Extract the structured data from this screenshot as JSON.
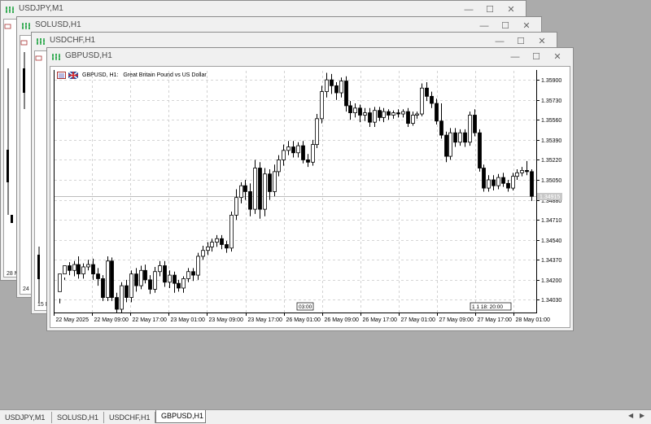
{
  "windows": [
    {
      "title": "USDJPY,M1",
      "stub_time": "28 M"
    },
    {
      "title": "SOLUSD,H1",
      "stub_time": "24 M"
    },
    {
      "title": "USDCHF,H1",
      "stub_time": "15 M"
    },
    {
      "title": "GBPUSD,H1"
    }
  ],
  "chart_window": {
    "header_symbol": "GBPUSD, H1:",
    "header_desc": "Great Britain Pound vs US Dollar",
    "current_price": "1.34915",
    "scroll_label_left": "03:00",
    "scroll_label_right": "1 1 18: 20:00"
  },
  "chart_data": {
    "type": "candlestick",
    "symbol": "GBPUSD",
    "timeframe": "H1",
    "ylim": [
      1.3395,
      1.3597
    ],
    "yticks": [
      "1.35900",
      "1.35730",
      "1.35560",
      "1.35390",
      "1.35220",
      "1.35050",
      "1.34880",
      "1.34710",
      "1.34540",
      "1.34370",
      "1.34200",
      "1.34030"
    ],
    "xticks": [
      "22 May 2025",
      "22 May 09:00",
      "22 May 17:00",
      "23 May 01:00",
      "23 May 09:00",
      "23 May 17:00",
      "26 May 01:00",
      "26 May 09:00",
      "26 May 17:00",
      "27 May 01:00",
      "27 May 09:00",
      "27 May 17:00",
      "28 May 01:00"
    ],
    "last_price": 1.34915,
    "candles": [
      [
        1.341,
        1.3425,
        1.3404,
        1.34
      ],
      [
        1.3425,
        1.3432,
        1.3422,
        1.342
      ],
      [
        1.3432,
        1.3428,
        1.3435,
        1.3424
      ],
      [
        1.3428,
        1.3433,
        1.3436,
        1.3423
      ],
      [
        1.3433,
        1.3425,
        1.344,
        1.3421
      ],
      [
        1.3425,
        1.3431,
        1.3434,
        1.3421
      ],
      [
        1.3431,
        1.3433,
        1.3437,
        1.3428
      ],
      [
        1.3433,
        1.3425,
        1.3438,
        1.342
      ],
      [
        1.3425,
        1.3421,
        1.343,
        1.3415
      ],
      [
        1.3421,
        1.3405,
        1.3424,
        1.3402
      ],
      [
        1.3405,
        1.3436,
        1.344,
        1.3402
      ],
      [
        1.3436,
        1.3405,
        1.3439,
        1.3402
      ],
      [
        1.3405,
        1.3395,
        1.3409,
        1.3392
      ],
      [
        1.3395,
        1.3415,
        1.3418,
        1.3392
      ],
      [
        1.3415,
        1.3405,
        1.342,
        1.3401
      ],
      [
        1.3405,
        1.3425,
        1.3428,
        1.3401
      ],
      [
        1.3425,
        1.3415,
        1.343,
        1.341
      ],
      [
        1.3415,
        1.3428,
        1.3432,
        1.3412
      ],
      [
        1.3428,
        1.342,
        1.3433,
        1.3417
      ],
      [
        1.342,
        1.3412,
        1.3424,
        1.3408
      ],
      [
        1.3412,
        1.3427,
        1.3431,
        1.3409
      ],
      [
        1.3427,
        1.3432,
        1.3436,
        1.3423
      ],
      [
        1.3432,
        1.3418,
        1.3436,
        1.3414
      ],
      [
        1.3418,
        1.3424,
        1.3428,
        1.3413
      ],
      [
        1.3424,
        1.3417,
        1.3427,
        1.3409
      ],
      [
        1.3417,
        1.3413,
        1.342,
        1.341
      ],
      [
        1.3413,
        1.3421,
        1.3423,
        1.3409
      ],
      [
        1.3421,
        1.3427,
        1.343,
        1.3418
      ],
      [
        1.3427,
        1.3424,
        1.343,
        1.3419
      ],
      [
        1.3424,
        1.344,
        1.3443,
        1.342
      ],
      [
        1.344,
        1.3445,
        1.3449,
        1.3437
      ],
      [
        1.3445,
        1.3448,
        1.3452,
        1.3441
      ],
      [
        1.3448,
        1.3452,
        1.3455,
        1.3444
      ],
      [
        1.3452,
        1.3455,
        1.3458,
        1.3448
      ],
      [
        1.3455,
        1.345,
        1.3458,
        1.3446
      ],
      [
        1.345,
        1.3447,
        1.3453,
        1.3443
      ],
      [
        1.3447,
        1.3475,
        1.3478,
        1.3444
      ],
      [
        1.3475,
        1.349,
        1.3497,
        1.3471
      ],
      [
        1.349,
        1.35,
        1.3503,
        1.3485
      ],
      [
        1.35,
        1.3495,
        1.3505,
        1.3488
      ],
      [
        1.3495,
        1.348,
        1.3502,
        1.3474
      ],
      [
        1.348,
        1.3515,
        1.3522,
        1.3476
      ],
      [
        1.3515,
        1.348,
        1.352,
        1.3472
      ],
      [
        1.348,
        1.351,
        1.3515,
        1.3474
      ],
      [
        1.351,
        1.3495,
        1.3514,
        1.3488
      ],
      [
        1.3495,
        1.3512,
        1.3518,
        1.3491
      ],
      [
        1.3512,
        1.3522,
        1.3526,
        1.3508
      ],
      [
        1.3522,
        1.353,
        1.3535,
        1.3517
      ],
      [
        1.353,
        1.3533,
        1.3538,
        1.3526
      ],
      [
        1.3533,
        1.3528,
        1.3538,
        1.3524
      ],
      [
        1.3528,
        1.3534,
        1.3537,
        1.3524
      ],
      [
        1.3534,
        1.3522,
        1.3538,
        1.3519
      ],
      [
        1.3522,
        1.352,
        1.3527,
        1.3516
      ],
      [
        1.352,
        1.3535,
        1.3539,
        1.3517
      ],
      [
        1.3535,
        1.3557,
        1.3561,
        1.3532
      ],
      [
        1.3557,
        1.358,
        1.3585,
        1.3553
      ],
      [
        1.358,
        1.359,
        1.3596,
        1.3575
      ],
      [
        1.359,
        1.3585,
        1.3595,
        1.3578
      ],
      [
        1.3585,
        1.3579,
        1.3588,
        1.3573
      ],
      [
        1.3579,
        1.3589,
        1.3592,
        1.3575
      ],
      [
        1.3589,
        1.3568,
        1.3593,
        1.3563
      ],
      [
        1.3568,
        1.3562,
        1.3572,
        1.3556
      ],
      [
        1.3562,
        1.3566,
        1.357,
        1.3558
      ],
      [
        1.3566,
        1.356,
        1.3569,
        1.3554
      ],
      [
        1.356,
        1.3562,
        1.3566,
        1.3555
      ],
      [
        1.3562,
        1.3554,
        1.3566,
        1.355
      ],
      [
        1.3554,
        1.3564,
        1.3567,
        1.355
      ],
      [
        1.3564,
        1.3558,
        1.3567,
        1.3555
      ],
      [
        1.3558,
        1.3563,
        1.3566,
        1.3554
      ],
      [
        1.3563,
        1.356,
        1.3565,
        1.3556
      ],
      [
        1.356,
        1.3562,
        1.3564,
        1.3557
      ],
      [
        1.3562,
        1.3561,
        1.3565,
        1.3558
      ],
      [
        1.3561,
        1.3563,
        1.3565,
        1.3558
      ],
      [
        1.3563,
        1.3553,
        1.3566,
        1.355
      ],
      [
        1.3553,
        1.356,
        1.3563,
        1.3551
      ],
      [
        1.356,
        1.3561,
        1.3563,
        1.3557
      ],
      [
        1.3561,
        1.3583,
        1.3587,
        1.3559
      ],
      [
        1.3583,
        1.3576,
        1.3588,
        1.3572
      ],
      [
        1.3576,
        1.357,
        1.358,
        1.3566
      ],
      [
        1.357,
        1.3555,
        1.3574,
        1.3552
      ],
      [
        1.3555,
        1.3543,
        1.357,
        1.354
      ],
      [
        1.3543,
        1.3525,
        1.3546,
        1.352
      ],
      [
        1.3525,
        1.3545,
        1.3549,
        1.3522
      ],
      [
        1.3545,
        1.3537,
        1.3549,
        1.3533
      ],
      [
        1.3537,
        1.3545,
        1.3548,
        1.3534
      ],
      [
        1.3545,
        1.3537,
        1.3548,
        1.3533
      ],
      [
        1.3537,
        1.356,
        1.3563,
        1.3534
      ],
      [
        1.356,
        1.3545,
        1.3565,
        1.3542
      ],
      [
        1.3545,
        1.3515,
        1.3548,
        1.3512
      ],
      [
        1.3515,
        1.3498,
        1.3518,
        1.3495
      ],
      [
        1.3498,
        1.3505,
        1.3509,
        1.3495
      ],
      [
        1.3505,
        1.35,
        1.3509,
        1.3496
      ],
      [
        1.35,
        1.3507,
        1.351,
        1.3497
      ],
      [
        1.3507,
        1.3502,
        1.3511,
        1.3499
      ],
      [
        1.3502,
        1.3498,
        1.3505,
        1.3495
      ],
      [
        1.3498,
        1.3508,
        1.3511,
        1.3496
      ],
      [
        1.3508,
        1.3511,
        1.3514,
        1.3505
      ],
      [
        1.3511,
        1.3513,
        1.3516,
        1.3508
      ],
      [
        1.3513,
        1.3512,
        1.3521,
        1.3509
      ],
      [
        1.3512,
        1.3491,
        1.3514,
        1.3487
      ]
    ]
  },
  "tabs": [
    {
      "label": "USDJPY,M1"
    },
    {
      "label": "SOLUSD,H1"
    },
    {
      "label": "USDCHF,H1"
    },
    {
      "label": "GBPUSD,H1"
    }
  ],
  "tab_nav": {
    "left": "◀",
    "right": "▶"
  },
  "colors": {
    "icon_green": "#2aa84a",
    "grid": "#c8c8c8",
    "bg": "#ababab"
  }
}
